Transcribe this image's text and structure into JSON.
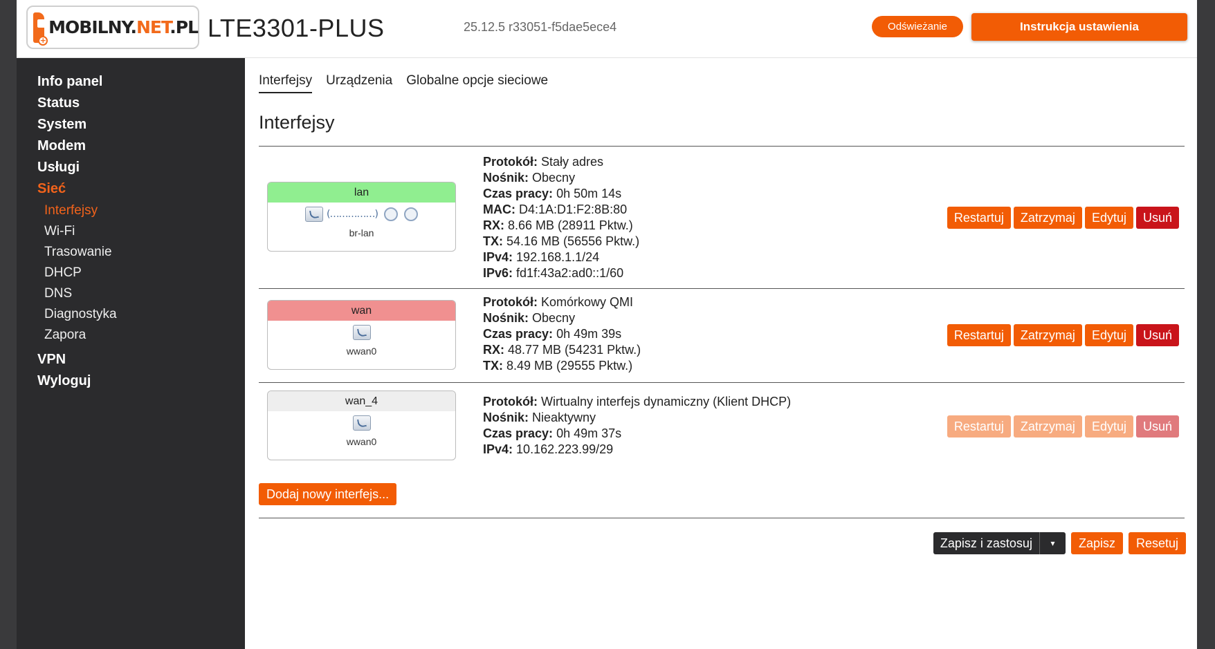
{
  "header": {
    "logo_text_a": "MOBILNY.",
    "logo_text_b": "NET",
    "logo_text_c": ".PL",
    "model": "LTE3301-PLUS",
    "firmware": "25.12.5 r33051-f5dae5ece4",
    "refresh_label": "Odświeżanie",
    "guide_label": "Instrukcja ustawienia"
  },
  "sidebar": {
    "items": [
      {
        "label": "Info panel"
      },
      {
        "label": "Status"
      },
      {
        "label": "System"
      },
      {
        "label": "Modem"
      },
      {
        "label": "Usługi"
      },
      {
        "label": "Sieć"
      },
      {
        "label": "VPN"
      },
      {
        "label": "Wyloguj"
      }
    ],
    "sub": [
      {
        "label": "Interfejsy"
      },
      {
        "label": "Wi-Fi"
      },
      {
        "label": "Trasowanie"
      },
      {
        "label": "DHCP"
      },
      {
        "label": "DNS"
      },
      {
        "label": "Diagnostyka"
      },
      {
        "label": "Zapora"
      }
    ]
  },
  "tabs": [
    {
      "label": "Interfejsy"
    },
    {
      "label": "Urządzenia"
    },
    {
      "label": "Globalne opcje sieciowe"
    }
  ],
  "page_title": "Interfejsy",
  "labels": {
    "protocol": "Protokół:",
    "carrier": "Nośnik:",
    "uptime": "Czas pracy:",
    "mac": "MAC:",
    "rx": "RX:",
    "tx": "TX:",
    "ipv4": "IPv4:",
    "ipv6": "IPv6:"
  },
  "interfaces": [
    {
      "name": "lan",
      "device": "br-lan",
      "status_color": "#90ee90",
      "port_strip": "(……………)",
      "port_close": ")",
      "protocol": "Stały adres",
      "carrier": "Obecny",
      "uptime": "0h 50m 14s",
      "mac": "D4:1A:D1:F2:8B:80",
      "rx": "8.66 MB (28911 Pktw.)",
      "tx": "54.16 MB (56556 Pktw.)",
      "ipv4": "192.168.1.1/24",
      "ipv6": "fd1f:43a2:ad0::1/60"
    },
    {
      "name": "wan",
      "device": "wwan0",
      "status_color": "#f09090",
      "protocol": "Komórkowy QMI",
      "carrier": "Obecny",
      "uptime": "0h 49m 39s",
      "rx": "48.77 MB (54231 Pktw.)",
      "tx": "8.49 MB (29555 Pktw.)"
    },
    {
      "name": "wan_4",
      "device": "wwan0",
      "status_color": "#eeeeee",
      "protocol": "Wirtualny interfejs dynamiczny (Klient DHCP)",
      "carrier": "Nieaktywny",
      "uptime": "0h 49m 37s",
      "ipv4": "10.162.223.99/29"
    }
  ],
  "actions": {
    "restart": "Restartuj",
    "stop": "Zatrzymaj",
    "edit": "Edytuj",
    "delete": "Usuń"
  },
  "add_label": "Dodaj nowy interfejs...",
  "footer": {
    "save_apply": "Zapisz i zastosuj",
    "dropdown": "▾",
    "save": "Zapisz",
    "reset": "Resetuj"
  },
  "colors": {
    "accent": "#f25c05",
    "danger": "#c9141a",
    "sidebar_bg": "#2b2b2d"
  }
}
